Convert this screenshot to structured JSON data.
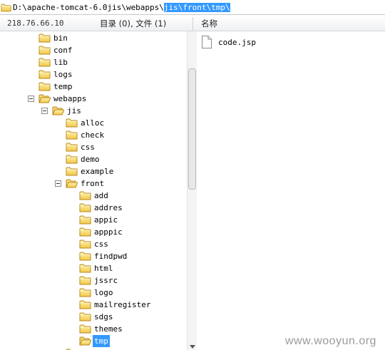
{
  "address": {
    "path_prefix": "D:\\apache-tomcat-6.0jis\\webapps\\",
    "path_selected": "jis\\front\\tmp\\"
  },
  "header": {
    "server": "218.76.66.10",
    "summary": "目录 (0), 文件 (1)",
    "name_col": "名称"
  },
  "tree": {
    "bin": "bin",
    "conf": "conf",
    "lib": "lib",
    "logs": "logs",
    "temp": "temp",
    "webapps": "webapps",
    "jis": "jis",
    "alloc": "alloc",
    "check": "check",
    "css": "css",
    "demo": "demo",
    "example": "example",
    "front": "front",
    "front_children": {
      "add": "add",
      "addres": "addres",
      "appic": "appic",
      "apppic": "apppic",
      "css": "css",
      "findpwd": "findpwd",
      "html": "html",
      "jssrc": "jssrc",
      "logo": "logo",
      "mailregister": "mailregister",
      "sdgs": "sdgs",
      "themes": "themes",
      "tmp": "tmp"
    }
  },
  "files": [
    {
      "name": "code.jsp"
    }
  ],
  "watermark": "www.wooyun.org"
}
